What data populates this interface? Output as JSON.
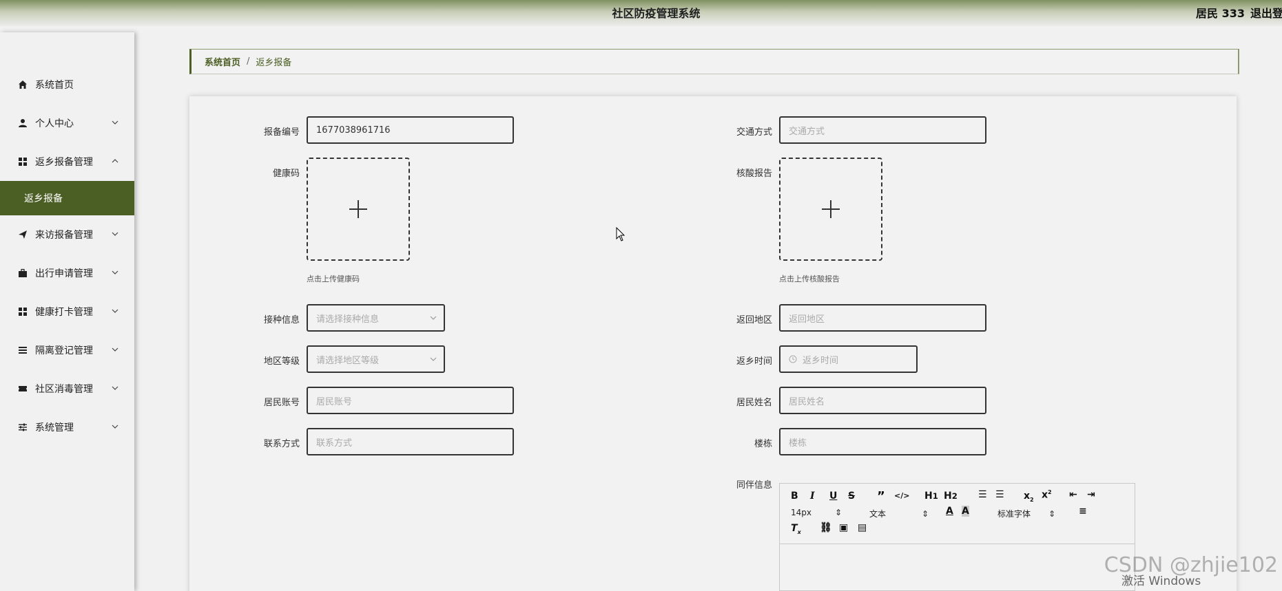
{
  "header": {
    "title": "社区防疫管理系统",
    "user_label": "居民 333",
    "logout_label": "退出登录"
  },
  "sidebar": {
    "items": [
      {
        "label": "系统首页",
        "icon": "home-icon"
      },
      {
        "label": "个人中心",
        "icon": "user-icon"
      },
      {
        "label": "返乡报备管理",
        "icon": "grid-icon"
      },
      {
        "label": "来访报备管理",
        "icon": "send-icon"
      },
      {
        "label": "出行申请管理",
        "icon": "briefcase-icon"
      },
      {
        "label": "健康打卡管理",
        "icon": "grid-icon"
      },
      {
        "label": "隔离登记管理",
        "icon": "list-icon"
      },
      {
        "label": "社区消毒管理",
        "icon": "ticket-icon"
      },
      {
        "label": "系统管理",
        "icon": "sliders-icon"
      }
    ],
    "active_sub": "返乡报备"
  },
  "breadcrumb": {
    "home": "系统首页",
    "separator": "/",
    "current": "返乡报备"
  },
  "form": {
    "report_no": {
      "label": "报备编号",
      "value": "1677038961716"
    },
    "transport": {
      "label": "交通方式",
      "placeholder": "交通方式"
    },
    "health_code": {
      "label": "健康码",
      "hint": "点击上传健康码"
    },
    "nucleic_report": {
      "label": "核酸报告",
      "hint": "点击上传核酸报告"
    },
    "vaccine": {
      "label": "接种信息",
      "placeholder": "请选择接种信息"
    },
    "return_region": {
      "label": "返回地区",
      "placeholder": "返回地区"
    },
    "region_level": {
      "label": "地区等级",
      "placeholder": "请选择地区等级"
    },
    "return_time": {
      "label": "返乡时间",
      "placeholder": "返乡时间"
    },
    "resident_account": {
      "label": "居民账号",
      "placeholder": "居民账号"
    },
    "resident_name": {
      "label": "居民姓名",
      "placeholder": "居民姓名"
    },
    "contact": {
      "label": "联系方式",
      "placeholder": "联系方式"
    },
    "building": {
      "label": "楼栋",
      "placeholder": "楼栋"
    },
    "companion": {
      "label": "同伴信息"
    }
  },
  "editor": {
    "font_size": "14px",
    "block_type": "文本",
    "font_family": "标准字体"
  },
  "overlays": {
    "watermark": "CSDN @zhjie102",
    "activate": "激活 Windows"
  }
}
